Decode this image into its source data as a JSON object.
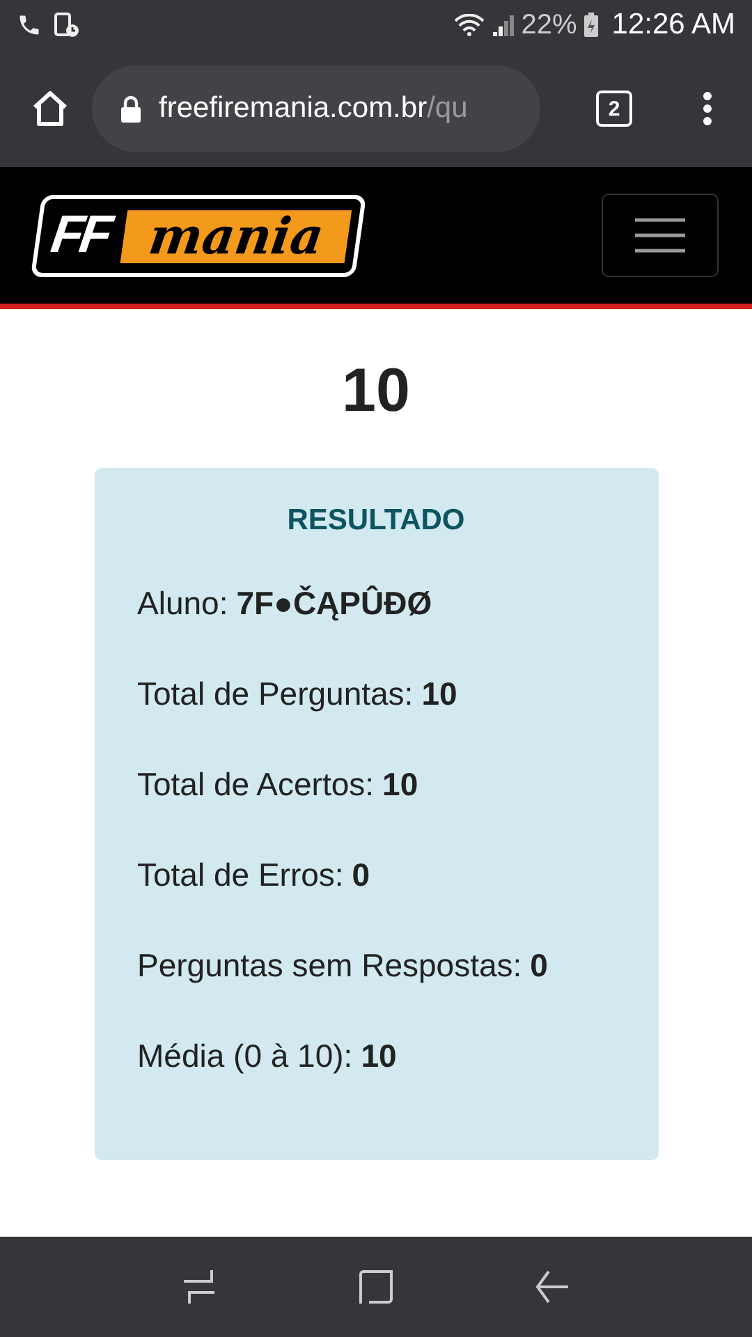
{
  "status_bar": {
    "battery": "22%",
    "time": "12:26 AM"
  },
  "browser": {
    "url_host": "freefiremania.com.br",
    "url_path": "/qu",
    "tab_count": "2"
  },
  "site_header": {
    "logo_left": "FF",
    "logo_right": "mania"
  },
  "score": "10",
  "result": {
    "title": "RESULTADO",
    "rows": [
      {
        "label": "Aluno:",
        "value": "7F●ČĄPÛĐØ"
      },
      {
        "label": "Total de Perguntas:",
        "value": "10"
      },
      {
        "label": "Total de Acertos:",
        "value": "10"
      },
      {
        "label": "Total de Erros:",
        "value": "0"
      },
      {
        "label": "Perguntas sem Respostas:",
        "value": "0"
      },
      {
        "label": "Média (0 à 10):",
        "value": "10"
      }
    ]
  }
}
